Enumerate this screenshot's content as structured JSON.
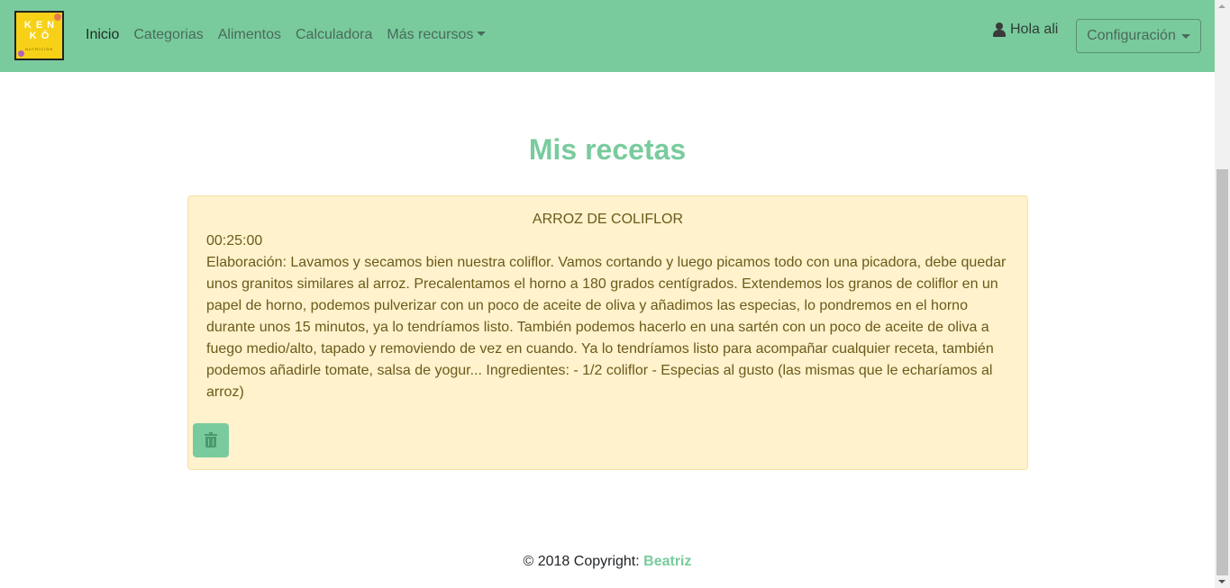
{
  "logo": {
    "line1": "KEN",
    "line2": "KŌ",
    "line3": "NUTRICIÓN"
  },
  "nav": {
    "items": [
      {
        "label": "Inicio"
      },
      {
        "label": "Categorias"
      },
      {
        "label": "Alimentos"
      },
      {
        "label": "Calculadora"
      },
      {
        "label": "Más recursos"
      }
    ],
    "greeting": "Hola ali",
    "config_label": "Configuración"
  },
  "main": {
    "title": "Mis recetas",
    "recipe": {
      "name": "ARROZ DE COLIFLOR",
      "time": "00:25:00",
      "text": "Elaboración: Lavamos y secamos bien nuestra coliflor. Vamos cortando y luego picamos todo con una picadora, debe quedar unos granitos similares al arroz. Precalentamos el horno a 180 grados centígrados. Extendemos los granos de coliflor en un papel de horno, podemos pulverizar con un poco de aceite de oliva y añadimos las especias, lo pondremos en el horno durante unos 15 minutos, ya lo tendríamos listo. También podemos hacerlo en una sartén con un poco de aceite de oliva a fuego medio/alto, tapado y removiendo de vez en cuando. Ya lo tendríamos listo para acompañar cualquier receta, también podemos añadirle tomate, salsa de yogur... Ingredientes: - 1/2 coliflor - Especias al gusto (las mismas que le echaríamos al arroz)"
    }
  },
  "footer": {
    "copyright": "© 2018 Copyright:",
    "author": "Beatriz"
  },
  "colors": {
    "navbar": "#79cb9d",
    "card_bg": "#fff2cc",
    "accent": "#79cb9d"
  }
}
